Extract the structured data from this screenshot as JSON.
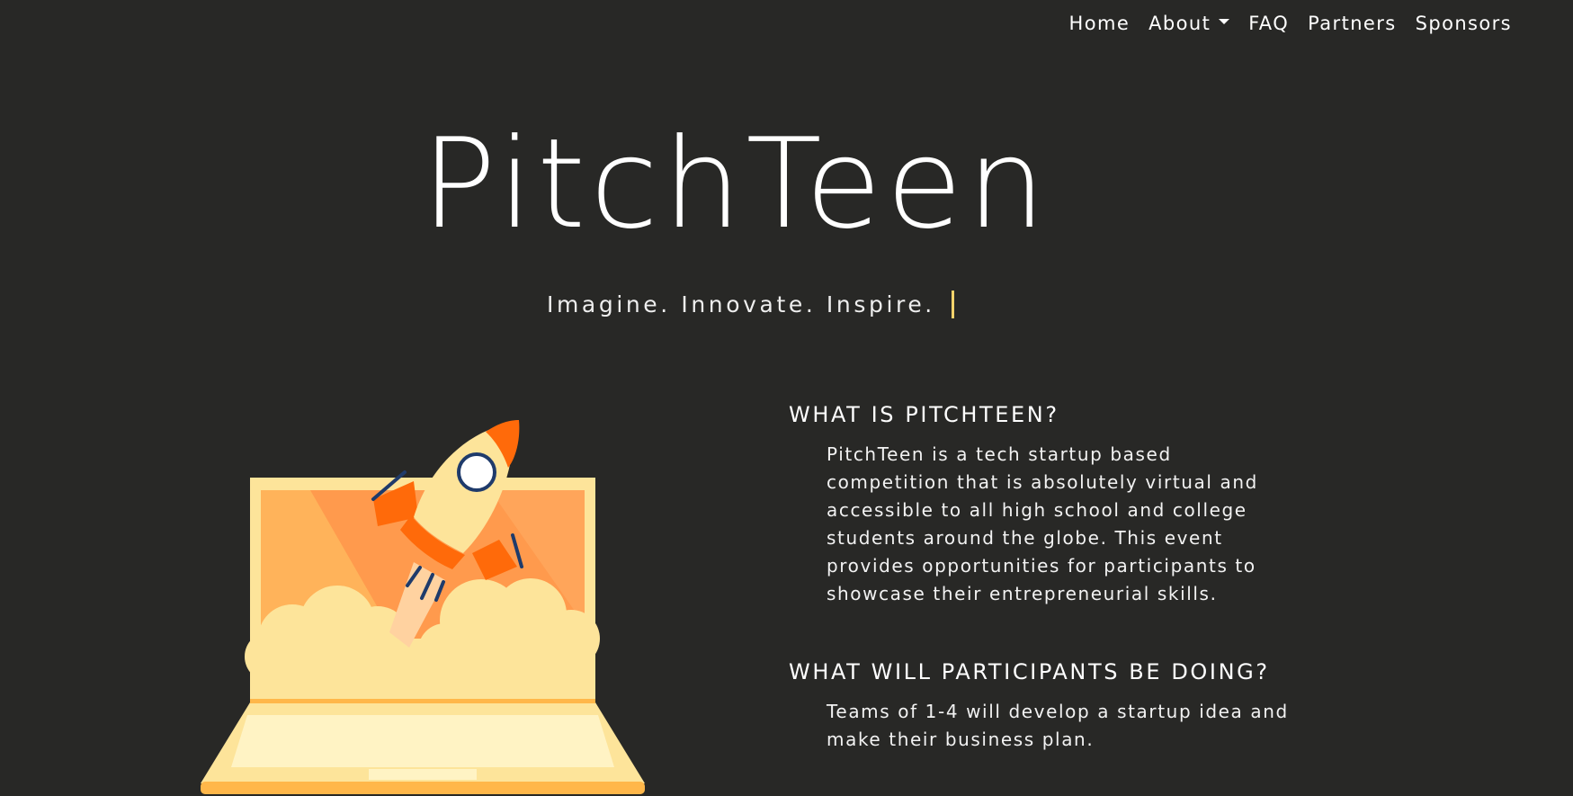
{
  "nav": {
    "home": "Home",
    "about": "About",
    "faq": "FAQ",
    "partners": "Partners",
    "sponsors": "Sponsors"
  },
  "hero": {
    "title": "PitchTeen",
    "tagline": "Imagine. Innovate. Inspire."
  },
  "sections": [
    {
      "heading": "WHAT IS PITCHTEEN?",
      "body": "PitchTeen is a tech startup based competition that is absolutely virtual and accessible to all high school and college students around the globe. This event provides opportunities for participants to showcase their entrepreneurial skills."
    },
    {
      "heading": "WHAT WILL PARTICIPANTS BE DOING?",
      "body": "Teams of 1-4 will develop a startup idea and make their business plan."
    }
  ],
  "illustration": {
    "icon": "rocket-launch-from-laptop-icon"
  },
  "colors": {
    "background": "#282826",
    "text": "#ffffff",
    "cursor": "#f5d36b",
    "laptop": "#fde49a",
    "rocket_accent": "#ff6a0a",
    "screen_orange": "#ff9a4d"
  }
}
